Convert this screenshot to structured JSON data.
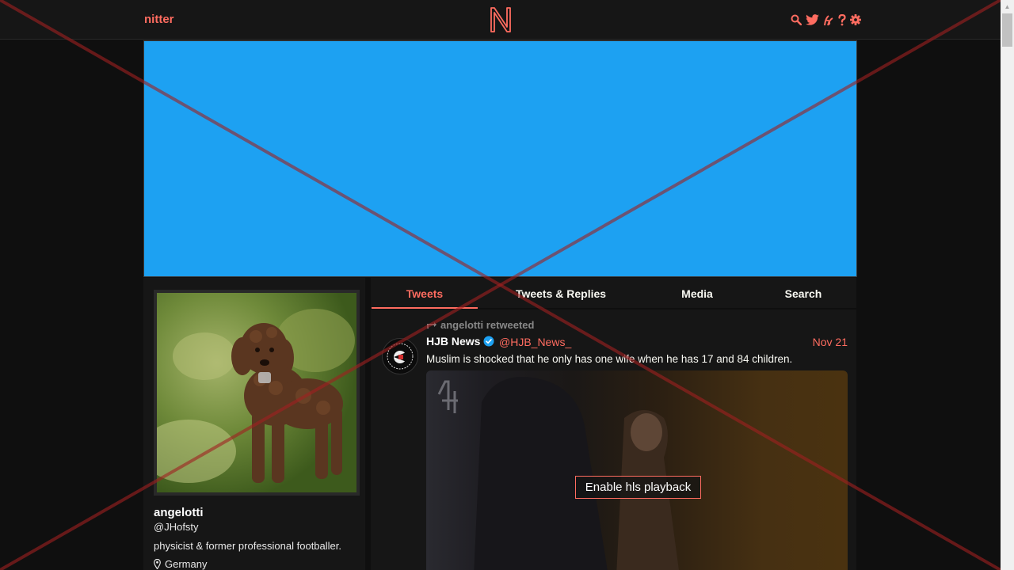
{
  "nav": {
    "brand": "nitter",
    "logo_letter": "N",
    "icons": [
      "search-icon",
      "twitter-bird-icon",
      "rss-icon",
      "help-icon",
      "gear-icon"
    ]
  },
  "profile": {
    "fullname": "angelotti",
    "username": "@JHofsty",
    "bio": "physicist & former professional footballer.",
    "location": "Germany"
  },
  "tabs": [
    {
      "label": "Tweets",
      "active": true
    },
    {
      "label": "Tweets & Replies",
      "active": false
    },
    {
      "label": "Media",
      "active": false
    },
    {
      "label": "Search",
      "active": false
    }
  ],
  "tweet": {
    "retweet_header": "angelotti retweeted",
    "name": "HJB News",
    "verified": true,
    "handle": "@HJB_News_",
    "date": "Nov 21",
    "text": "Muslim is shocked that he only has one wife when he has 17 and 84 children.",
    "video_button": "Enable hls playback"
  },
  "colors": {
    "accent": "#ff6c60",
    "banner": "#1da1f2",
    "background": "#0f0f0f",
    "panel": "#161616"
  }
}
